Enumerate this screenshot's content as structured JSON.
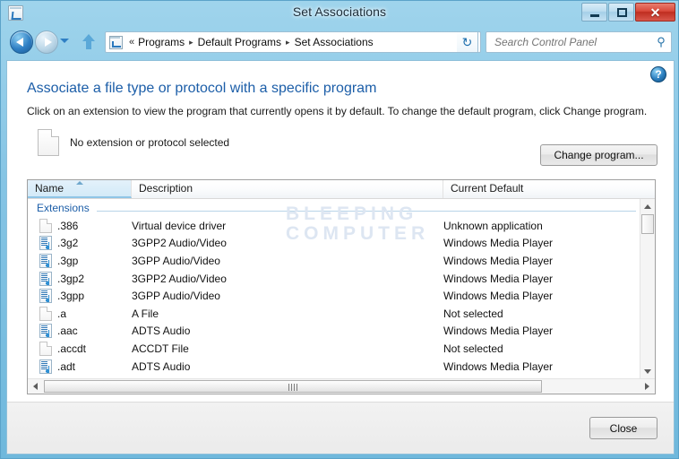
{
  "window": {
    "title": "Set Associations",
    "icon": "control-panel-icon",
    "minimize_label": "–",
    "maximize_label": "□",
    "close_label": "✕"
  },
  "nav": {
    "back_label": "Back",
    "forward_label": "Forward",
    "history_label": "Recent pages",
    "up_label": "Up",
    "refresh_label": "↻",
    "breadcrumb_chevron": "«",
    "breadcrumb_separator": "▸",
    "breadcrumbs": [
      {
        "label": "Programs"
      },
      {
        "label": "Default Programs"
      },
      {
        "label": "Set Associations"
      }
    ]
  },
  "search": {
    "placeholder": "Search Control Panel",
    "value": "",
    "icon": "search-icon"
  },
  "help": {
    "label": "?"
  },
  "page": {
    "title": "Associate a file type or protocol with a specific program",
    "description": "Click on an extension to view the program that currently opens it by default. To change the default program, click Change program.",
    "selection_text": "No extension or protocol selected",
    "change_program_label": "Change program..."
  },
  "watermark": {
    "line1": "BLEEPING",
    "line2": "COMPUTER"
  },
  "list": {
    "columns": [
      {
        "key": "name",
        "label": "Name",
        "sorted": true,
        "sort_dir": "asc"
      },
      {
        "key": "description",
        "label": "Description",
        "sorted": false
      },
      {
        "key": "current_default",
        "label": "Current Default",
        "sorted": false
      }
    ],
    "group_header": "Extensions",
    "rows": [
      {
        "icon": "blank-document-icon",
        "name": ".386",
        "description": "Virtual device driver",
        "current_default": "Unknown application"
      },
      {
        "icon": "media-file-icon",
        "name": ".3g2",
        "description": "3GPP2 Audio/Video",
        "current_default": "Windows Media Player"
      },
      {
        "icon": "media-file-icon",
        "name": ".3gp",
        "description": "3GPP Audio/Video",
        "current_default": "Windows Media Player"
      },
      {
        "icon": "media-file-icon",
        "name": ".3gp2",
        "description": "3GPP2 Audio/Video",
        "current_default": "Windows Media Player"
      },
      {
        "icon": "media-file-icon",
        "name": ".3gpp",
        "description": "3GPP Audio/Video",
        "current_default": "Windows Media Player"
      },
      {
        "icon": "blank-document-icon",
        "name": ".a",
        "description": "A File",
        "current_default": "Not selected"
      },
      {
        "icon": "media-file-icon",
        "name": ".aac",
        "description": "ADTS Audio",
        "current_default": "Windows Media Player"
      },
      {
        "icon": "blank-document-icon",
        "name": ".accdt",
        "description": "ACCDT File",
        "current_default": "Not selected"
      },
      {
        "icon": "media-file-icon",
        "name": ".adt",
        "description": "ADTS Audio",
        "current_default": "Windows Media Player"
      }
    ]
  },
  "scrollbars": {
    "vertical_up": "▲",
    "vertical_down": "▼",
    "horizontal_left": "◀",
    "horizontal_right": "▶"
  },
  "footer": {
    "close_label": "Close"
  },
  "colors": {
    "frame": "#6fb8dc",
    "accent_link": "#1c5ea8",
    "close_button": "#bf2d20",
    "watermark": "#dde6f2"
  }
}
